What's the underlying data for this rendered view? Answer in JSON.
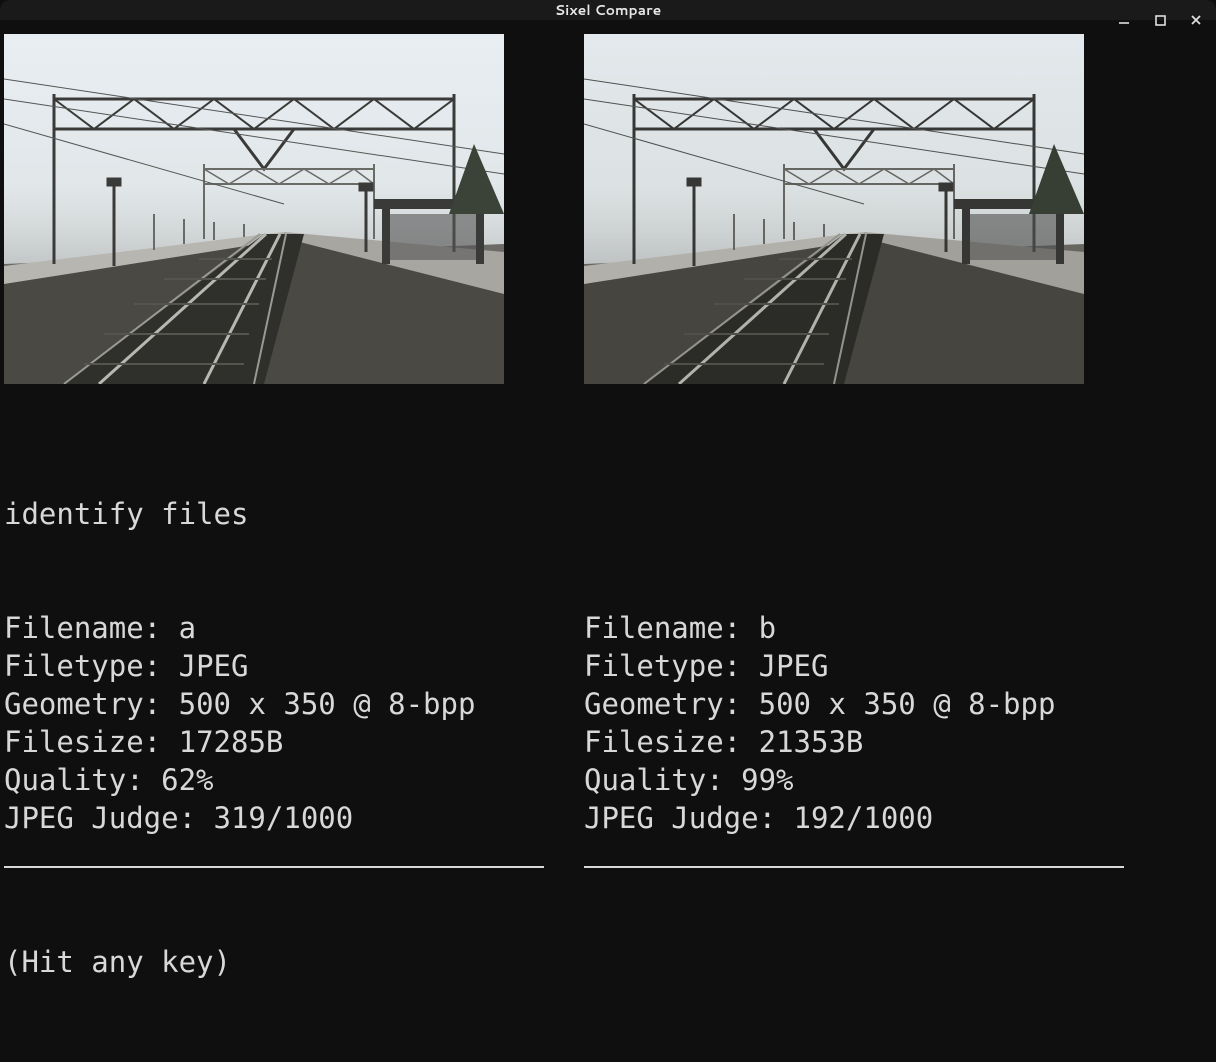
{
  "window": {
    "title": "Sixel Compare"
  },
  "header_line": "identify files",
  "left": {
    "filename_label": "Filename: ",
    "filename": "a",
    "filetype_label": "Filetype: ",
    "filetype": "JPEG",
    "geometry_label": "Geometry: ",
    "geometry": "500 x 350 @ 8-bpp",
    "filesize_label": "Filesize: ",
    "filesize": "17285B",
    "quality_label": "Quality: ",
    "quality": "62%",
    "judge_label": "JPEG Judge: ",
    "judge": "319/1000"
  },
  "right": {
    "filename_label": "Filename: ",
    "filename": "b",
    "filetype_label": "Filetype: ",
    "filetype": "JPEG",
    "geometry_label": "Geometry: ",
    "geometry": "500 x 350 @ 8-bpp",
    "filesize_label": "Filesize: ",
    "filesize": "21353B",
    "quality_label": "Quality: ",
    "quality": "99%",
    "judge_label": "JPEG Judge: ",
    "judge": "192/1000"
  },
  "prompt": "(Hit any key)"
}
